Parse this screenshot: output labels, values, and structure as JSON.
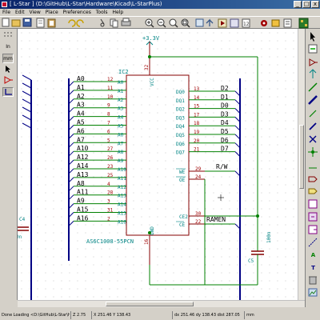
{
  "window": {
    "title": "[ L-Star ] (D:\\GitHub\\L-Star\\Hardware\\Kicad\\L-StarPlus)",
    "minimize": "_",
    "maximize": "□",
    "close": "x"
  },
  "menu": [
    "File",
    "Edit",
    "View",
    "Place",
    "Preferences",
    "Tools",
    "Help"
  ],
  "left_tools": [
    "In",
    "mm"
  ],
  "right_tools": [
    "A",
    "T"
  ],
  "schematic": {
    "power_label": "+3.3V",
    "ic_ref": "IC2",
    "ic_value": "AS6C1008-55PCN",
    "vcc_label": "VCC",
    "gnd_label": "GND",
    "c4_ref": "C4",
    "c4_value": "0n",
    "c5_ref": "C5",
    "c5_value": "100n",
    "rw_label": "R/W",
    "ramen_label": "RAMEN",
    "pin_32": "32",
    "pin_16": "16",
    "address_pins": [
      {
        "net": "A0",
        "pin": "12",
        "name": "A0"
      },
      {
        "net": "A1",
        "pin": "11",
        "name": "A1"
      },
      {
        "net": "A2",
        "pin": "10",
        "name": "A2"
      },
      {
        "net": "A3",
        "pin": "9",
        "name": "A3"
      },
      {
        "net": "A4",
        "pin": "8",
        "name": "A4"
      },
      {
        "net": "A5",
        "pin": "7",
        "name": "A5"
      },
      {
        "net": "A6",
        "pin": "6",
        "name": "A6"
      },
      {
        "net": "A7",
        "pin": "5",
        "name": "A7"
      },
      {
        "net": "A10",
        "pin": "27",
        "name": "A8"
      },
      {
        "net": "A12",
        "pin": "26",
        "name": "A9"
      },
      {
        "net": "A14",
        "pin": "23",
        "name": "A10"
      },
      {
        "net": "A13",
        "pin": "25",
        "name": "A11"
      },
      {
        "net": "A8",
        "pin": "4",
        "name": "A12"
      },
      {
        "net": "A11",
        "pin": "28",
        "name": "A13"
      },
      {
        "net": "A9",
        "pin": "3",
        "name": "A14"
      },
      {
        "net": "A15",
        "pin": "31",
        "name": "A15"
      },
      {
        "net": "A16",
        "pin": "2",
        "name": "A16"
      }
    ],
    "data_pins": [
      {
        "net": "D2",
        "pin": "13",
        "name": "DQ0"
      },
      {
        "net": "D1",
        "pin": "14",
        "name": "DQ1"
      },
      {
        "net": "D0",
        "pin": "15",
        "name": "DQ2"
      },
      {
        "net": "D3",
        "pin": "17",
        "name": "DQ3"
      },
      {
        "net": "D4",
        "pin": "18",
        "name": "DQ4"
      },
      {
        "net": "D5",
        "pin": "19",
        "name": "DQ5"
      },
      {
        "net": "D6",
        "pin": "20",
        "name": "DQ6"
      },
      {
        "net": "D7",
        "pin": "21",
        "name": "DQ7"
      }
    ],
    "ctrl_pins": [
      {
        "name": "WE",
        "pin": "29"
      },
      {
        "name": "OE",
        "pin": "24"
      },
      {
        "name": "CE2",
        "pin": "30"
      },
      {
        "name": "CE",
        "pin": "22"
      }
    ]
  },
  "status": {
    "message": "Done Loading <D:\\GitHub\\L-Star\\Hard...",
    "zoom": "Z 2.75",
    "xy": "X 251.46  Y 138.43",
    "dxdy": "dx 251.46  dy 138.43  dist 287.05",
    "units": "mm"
  },
  "colors": {
    "wire": "#008000",
    "bus": "#000084",
    "component": "#840000",
    "pin_name": "#008484",
    "pin_number": "#a00000",
    "power": "#008484",
    "label": "#000000"
  }
}
